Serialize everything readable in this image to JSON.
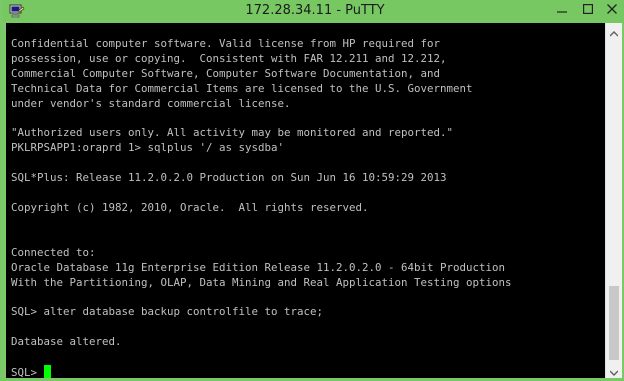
{
  "window": {
    "title": "172.28.34.11 - PuTTY",
    "accent_color": "#79c966",
    "app_icon": "putty-icon",
    "controls": {
      "minimize": "minimize-icon",
      "maximize": "maximize-icon",
      "close": "close-icon"
    }
  },
  "terminal": {
    "background": "#000000",
    "text_color": "#c0c0c0",
    "cursor_color": "#00ff00",
    "lines": [
      "Confidential computer software. Valid license from HP required for",
      "possession, use or copying.  Consistent with FAR 12.211 and 12.212,",
      "Commercial Computer Software, Computer Software Documentation, and",
      "Technical Data for Commercial Items are licensed to the U.S. Government",
      "under vendor's standard commercial license.",
      "",
      "\"Authorized users only. All activity may be monitored and reported.\"",
      "PKLRPSAPP1:oraprd 1> sqlplus '/ as sysdba'",
      "",
      "SQL*Plus: Release 11.2.0.2.0 Production on Sun Jun 16 10:59:29 2013",
      "",
      "Copyright (c) 1982, 2010, Oracle.  All rights reserved.",
      "",
      "",
      "Connected to:",
      "Oracle Database 11g Enterprise Edition Release 11.2.0.2.0 - 64bit Production",
      "With the Partitioning, OLAP, Data Mining and Real Application Testing options",
      "",
      "SQL> alter database backup controlfile to trace;",
      "",
      "Database altered.",
      ""
    ],
    "prompt": "SQL> "
  }
}
